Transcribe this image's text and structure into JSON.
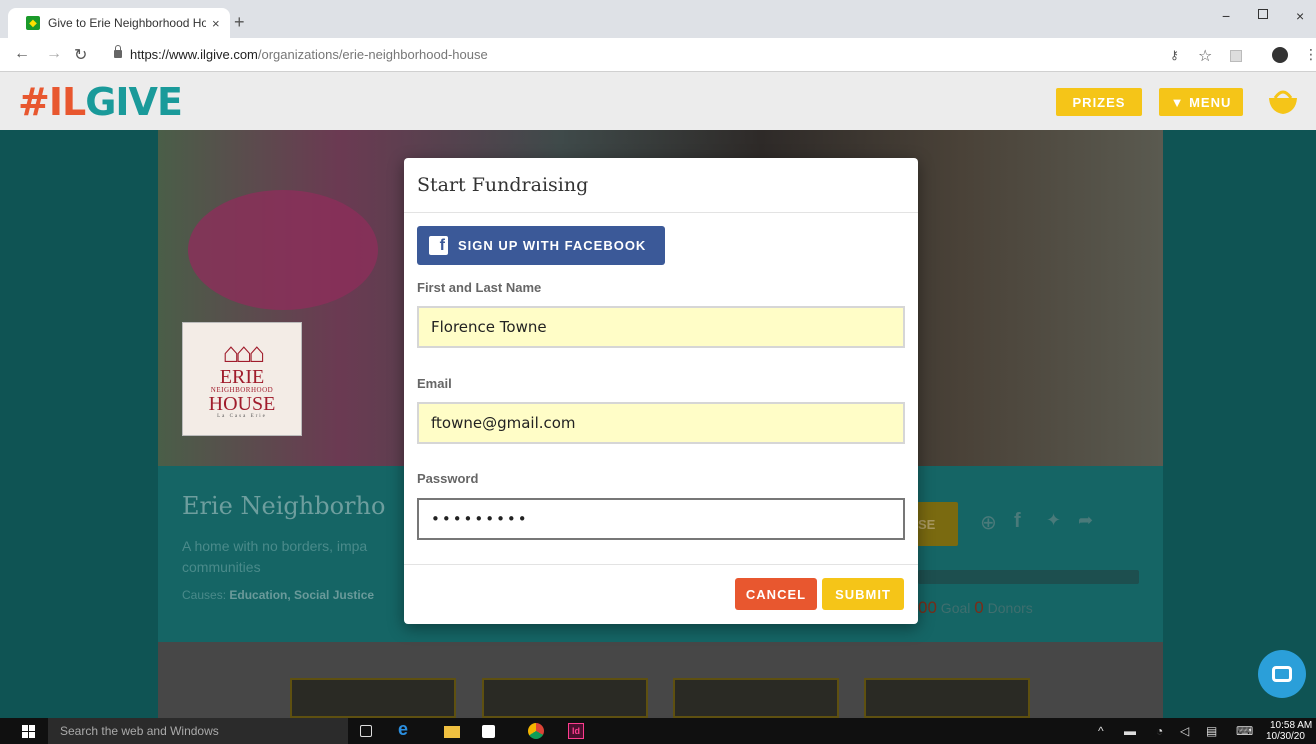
{
  "browser": {
    "tab_title": "Give to Erie Neighborhood Hous",
    "tab_close": "×",
    "new_tab": "+",
    "url_host": "https://www.ilgive.com",
    "url_path": "/organizations/erie-neighborhood-house",
    "window_minimize": "−",
    "window_close": "×"
  },
  "header": {
    "logo_hash": "#",
    "logo_il": "IL",
    "logo_give": "GIVE",
    "prizes_label": "PRIZES",
    "menu_label": "▼ MENU"
  },
  "org": {
    "logo_line1": "ERIE",
    "logo_line2": "NEIGHBORHOOD",
    "logo_line3": "HOUSE",
    "logo_line4": "La Casa Erie",
    "name": "Erie Neighborho",
    "description": "A home with no borders, impa communities",
    "causes_label": "Causes: ",
    "causes_value": "Education, Social Justice",
    "donate_partial": "SE",
    "goal_number": "00",
    "goal_label": " Goal ",
    "donors_number": "0",
    "donors_label": " Donors"
  },
  "modal": {
    "title": "Start Fundraising",
    "facebook_label": "SIGN UP WITH FACEBOOK",
    "name_label": "First and Last Name",
    "name_value": "Florence Towne",
    "email_label": "Email",
    "email_value": "ftowne@gmail.com",
    "password_label": "Password",
    "password_value": "•••••••••",
    "cancel_label": "CANCEL",
    "submit_label": "SUBMIT"
  },
  "taskbar": {
    "search_placeholder": "Search the web and Windows",
    "time": "10:58 AM",
    "date": "10/30/20"
  },
  "colors": {
    "brand_orange": "#e8572f",
    "brand_teal": "#1a9a9a",
    "brand_yellow": "#f5c518",
    "facebook_blue": "#3b5998",
    "autofill_yellow": "#fffdc7"
  },
  "icons": [
    "favicon-icon",
    "back-icon",
    "forward-icon",
    "reload-icon",
    "lock-icon",
    "key-icon",
    "star-icon",
    "pdf-icon",
    "profile-icon",
    "more-icon",
    "basket-icon",
    "facebook-icon",
    "twitter-icon",
    "share-icon",
    "chat-icon",
    "windows-start-icon",
    "task-view-icon",
    "edge-icon",
    "explorer-icon",
    "store-icon",
    "chrome-icon",
    "indesign-icon"
  ]
}
